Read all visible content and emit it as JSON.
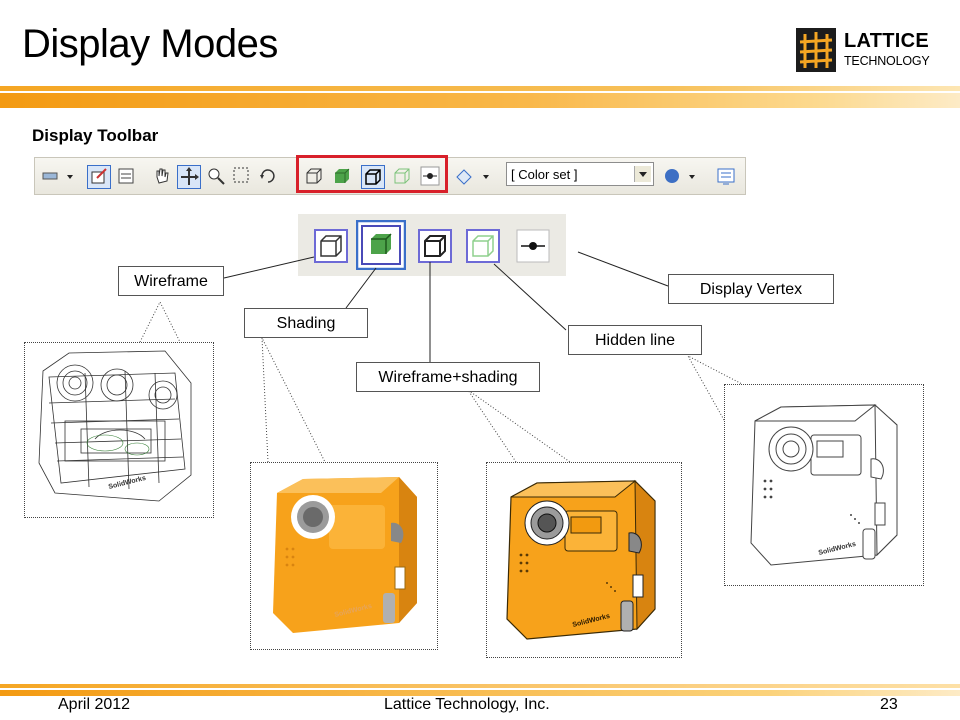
{
  "slide": {
    "title": "Display Modes",
    "section_heading": "Display Toolbar"
  },
  "logo": {
    "line1": "LATTICE",
    "line2": "TECHNOLOGY"
  },
  "toolbar": {
    "color_set": "[ Color set ]",
    "display_mode_icons": [
      "wireframe-icon",
      "shading-icon",
      "wireframe-shading-icon",
      "hidden-line-icon",
      "display-vertex-icon"
    ]
  },
  "callouts": {
    "wireframe": "Wireframe",
    "shading": "Shading",
    "wireframe_shading": "Wireframe+shading",
    "hidden_line": "Hidden line",
    "display_vertex": "Display Vertex"
  },
  "panels": {
    "watermark": "SolidWorks"
  },
  "footer": {
    "date": "April 2012",
    "company": "Lattice Technology, Inc.",
    "page": "23"
  },
  "colors": {
    "accent_orange": "#f39a12",
    "highlight_red": "#d8202a",
    "camera_orange": "#f7a21b"
  }
}
